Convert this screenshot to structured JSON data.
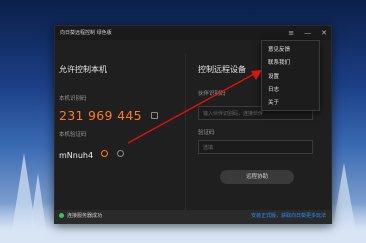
{
  "window": {
    "title": "向日葵远程控制 绿色版"
  },
  "window_controls": {
    "menu": "≡",
    "minimize": "—",
    "close": "✕"
  },
  "left_panel": {
    "heading": "允许控制本机",
    "id_label": "本机识别码",
    "id_value": "231 969 445",
    "code_label": "本机验证码",
    "code_value": "mNnuh4"
  },
  "right_panel": {
    "heading": "控制远程设备",
    "partner_label": "伙伴识别码",
    "partner_placeholder": "输入伙伴识别码，连接伙伴",
    "verify_label": "验证码",
    "verify_placeholder": "选填",
    "connect_button": "远程协助"
  },
  "status": {
    "connection_text": "连接服务器成功",
    "notice_text": "安装正式版，获取向日葵更多玩法"
  },
  "menu": {
    "items": [
      "意见反馈",
      "联系我们",
      "设置",
      "日志",
      "关于"
    ]
  },
  "colors": {
    "id_orange": "#ff7a2b",
    "link_blue": "#2b8cff",
    "status_green": "#35c553",
    "arrow_red": "#e01010"
  }
}
